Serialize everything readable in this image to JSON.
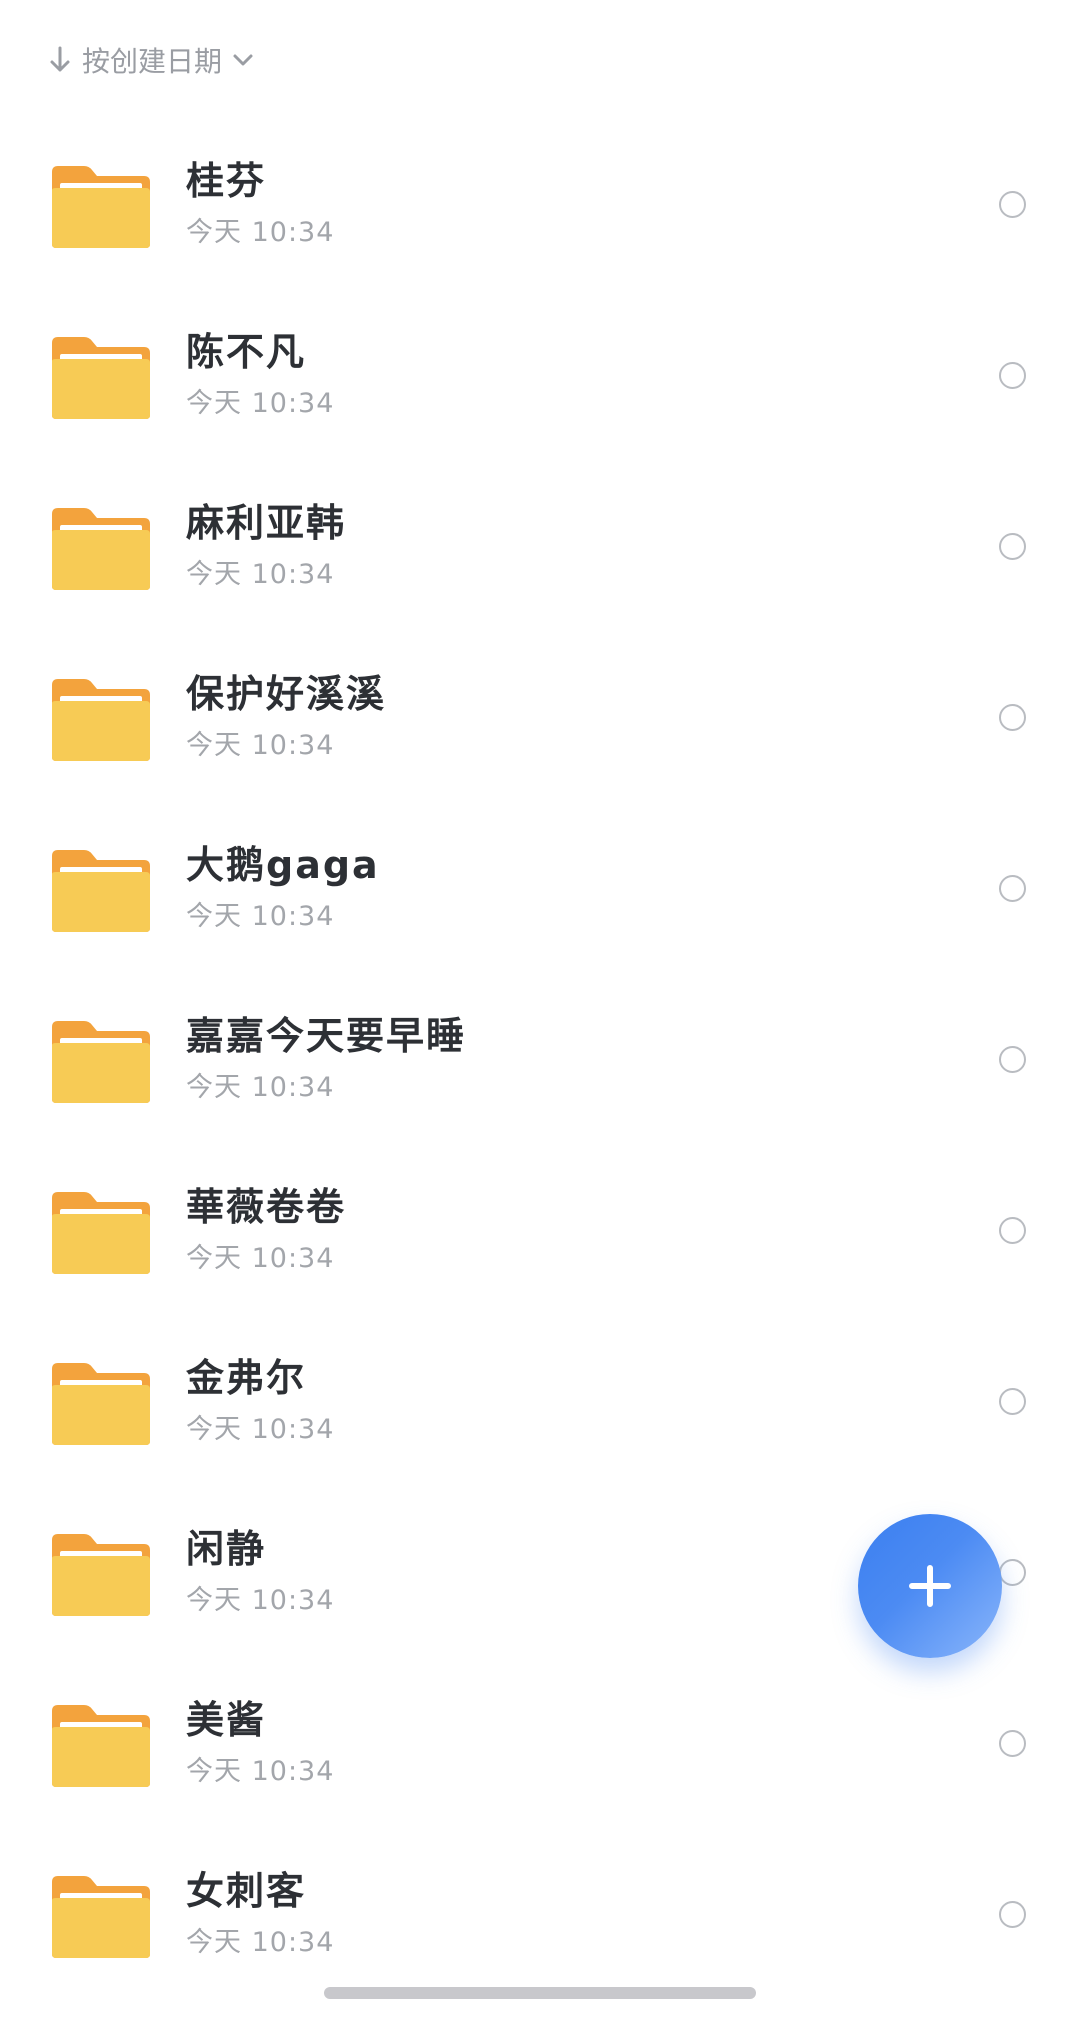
{
  "sort": {
    "label": "按创建日期",
    "arrow_icon": "arrow-down-icon",
    "chevron_icon": "chevron-down-icon"
  },
  "colors": {
    "folder_back": "#f3a33d",
    "folder_front": "#f7cb55",
    "fab": "#3b7ff0",
    "text_primary": "#2d3035",
    "text_secondary": "#a3a6ab"
  },
  "folders": [
    {
      "name": "桂芬",
      "date": "今天 10:34",
      "icon": "folder-icon"
    },
    {
      "name": "陈不凡",
      "date": "今天 10:34",
      "icon": "folder-icon"
    },
    {
      "name": "麻利亚韩",
      "date": "今天 10:34",
      "icon": "folder-icon"
    },
    {
      "name": "保护好溪溪",
      "date": "今天 10:34",
      "icon": "folder-icon"
    },
    {
      "name": "大鹅gaga",
      "date": "今天 10:34",
      "icon": "folder-icon"
    },
    {
      "name": "嘉嘉今天要早睡",
      "date": "今天 10:34",
      "icon": "folder-icon"
    },
    {
      "name": "華薇卷卷",
      "date": "今天 10:34",
      "icon": "folder-icon"
    },
    {
      "name": "金弗尔",
      "date": "今天 10:34",
      "icon": "folder-icon"
    },
    {
      "name": "闲静",
      "date": "今天 10:34",
      "icon": "folder-icon"
    },
    {
      "name": "美酱",
      "date": "今天 10:34",
      "icon": "folder-icon"
    },
    {
      "name": "女刺客",
      "date": "今天 10:34",
      "icon": "folder-icon"
    }
  ],
  "fab": {
    "icon": "plus-icon"
  }
}
